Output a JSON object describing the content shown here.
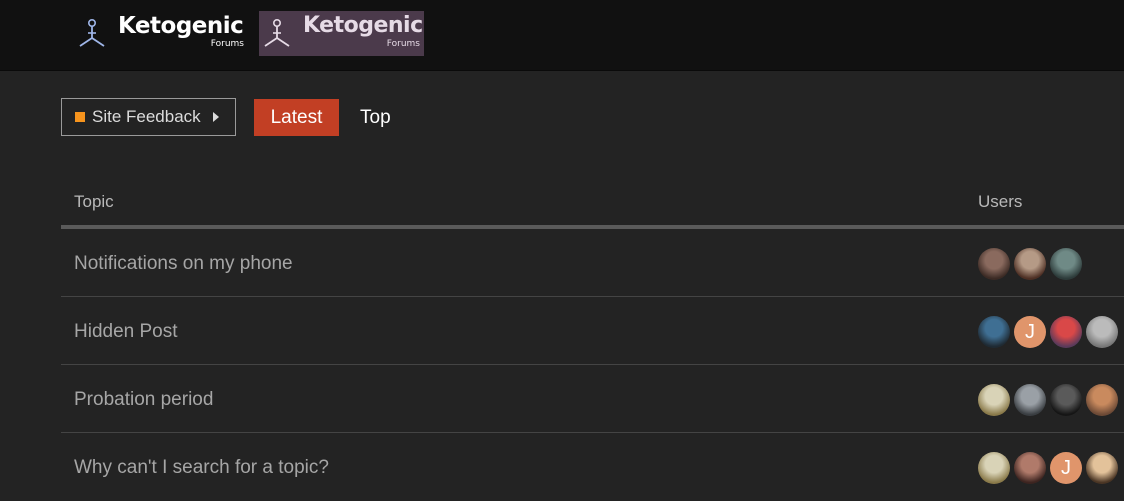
{
  "header": {
    "logo_primary": {
      "word": "Ketogenic",
      "sub": "Forums"
    },
    "logo_secondary": {
      "word": "Ketogenic",
      "sub": "Forums"
    }
  },
  "nav": {
    "category": {
      "label": "Site Feedback",
      "color": "#f7941d"
    },
    "tabs": [
      {
        "label": "Latest",
        "active": true
      },
      {
        "label": "Top",
        "active": false
      }
    ]
  },
  "list": {
    "columns": {
      "topic": "Topic",
      "users": "Users"
    },
    "topics": [
      {
        "title": "Notifications on my phone",
        "avatars": [
          {
            "kind": "photo",
            "colors": [
              "#8a6a5e",
              "#3b2a24"
            ]
          },
          {
            "kind": "photo",
            "colors": [
              "#b59a86",
              "#4d2f24"
            ]
          },
          {
            "kind": "photo",
            "colors": [
              "#6f8a86",
              "#2d3b3a"
            ]
          }
        ]
      },
      {
        "title": "Hidden Post",
        "avatars": [
          {
            "kind": "photo",
            "colors": [
              "#3f6f93",
              "#1f2a33"
            ]
          },
          {
            "kind": "letter",
            "letter": "J",
            "colors": [
              "#e0956b",
              "#e0956b"
            ]
          },
          {
            "kind": "photo",
            "colors": [
              "#d94848",
              "#5a3a5a"
            ]
          },
          {
            "kind": "photo",
            "colors": [
              "#bbbbbb",
              "#777777"
            ]
          }
        ]
      },
      {
        "title": "Probation period",
        "avatars": [
          {
            "kind": "photo",
            "colors": [
              "#d9d3b7",
              "#8a7a4a"
            ]
          },
          {
            "kind": "photo",
            "colors": [
              "#9aa0a6",
              "#3a3e42"
            ]
          },
          {
            "kind": "photo",
            "colors": [
              "#5a5a5a",
              "#151515"
            ]
          },
          {
            "kind": "photo",
            "colors": [
              "#c98a5e",
              "#6d4a36"
            ]
          }
        ]
      },
      {
        "title": "Why can't I search for a topic?",
        "avatars": [
          {
            "kind": "photo",
            "colors": [
              "#d9d3b7",
              "#8a7a4a"
            ]
          },
          {
            "kind": "photo",
            "colors": [
              "#b07a6a",
              "#3d2420"
            ]
          },
          {
            "kind": "letter",
            "letter": "J",
            "colors": [
              "#e0956b",
              "#e0956b"
            ]
          },
          {
            "kind": "photo",
            "colors": [
              "#e3c29a",
              "#4a3524"
            ]
          }
        ]
      }
    ]
  }
}
